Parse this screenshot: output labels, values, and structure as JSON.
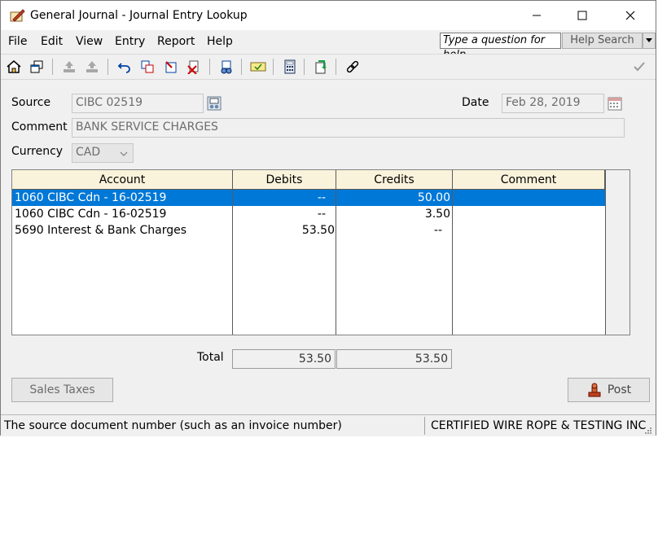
{
  "window": {
    "title": "General Journal - Journal Entry Lookup"
  },
  "menu": [
    "File",
    "Edit",
    "View",
    "Entry",
    "Report",
    "Help"
  ],
  "help": {
    "question_placeholder": "Type a question for help",
    "search_label": "Help Search"
  },
  "form": {
    "source_label": "Source",
    "source_value": "CIBC 02519",
    "date_label": "Date",
    "date_value": "Feb 28, 2019",
    "comment_label": "Comment",
    "comment_value": "BANK SERVICE CHARGES",
    "currency_label": "Currency",
    "currency_value": "CAD"
  },
  "grid": {
    "headers": {
      "account": "Account",
      "debits": "Debits",
      "credits": "Credits",
      "comment": "Comment"
    },
    "rows": [
      {
        "account": "1060 CIBC Cdn - 16-02519",
        "debits": "--",
        "credits": "50.00",
        "comment": "",
        "selected": true
      },
      {
        "account": "1060 CIBC Cdn - 16-02519",
        "debits": "--",
        "credits": "3.50",
        "comment": "",
        "selected": false
      },
      {
        "account": "5690 Interest & Bank Charges",
        "debits": "53.50",
        "credits": "--",
        "comment": "",
        "selected": false
      }
    ]
  },
  "totals": {
    "label": "Total",
    "debits": "53.50",
    "credits": "53.50"
  },
  "buttons": {
    "sales_taxes": "Sales Taxes",
    "post": "Post"
  },
  "status": {
    "hint": "The source document number (such as an invoice number)",
    "company": "CERTIFIED WIRE ROPE & TESTING INC"
  },
  "colors": {
    "selection": "#0078d7",
    "header_bg": "#faf3dc"
  }
}
